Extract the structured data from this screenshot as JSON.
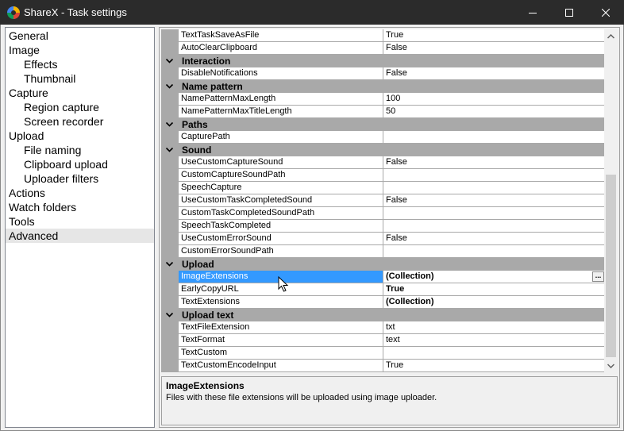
{
  "window": {
    "title": "ShareX - Task settings"
  },
  "tree": {
    "items": [
      {
        "label": "General",
        "child": false,
        "selected": false
      },
      {
        "label": "Image",
        "child": false,
        "selected": false
      },
      {
        "label": "Effects",
        "child": true,
        "selected": false
      },
      {
        "label": "Thumbnail",
        "child": true,
        "selected": false
      },
      {
        "label": "Capture",
        "child": false,
        "selected": false
      },
      {
        "label": "Region capture",
        "child": true,
        "selected": false
      },
      {
        "label": "Screen recorder",
        "child": true,
        "selected": false
      },
      {
        "label": "Upload",
        "child": false,
        "selected": false
      },
      {
        "label": "File naming",
        "child": true,
        "selected": false
      },
      {
        "label": "Clipboard upload",
        "child": true,
        "selected": false
      },
      {
        "label": "Uploader filters",
        "child": true,
        "selected": false
      },
      {
        "label": "Actions",
        "child": false,
        "selected": false
      },
      {
        "label": "Watch folders",
        "child": false,
        "selected": false
      },
      {
        "label": "Tools",
        "child": false,
        "selected": false
      },
      {
        "label": "Advanced",
        "child": false,
        "selected": true
      }
    ]
  },
  "grid": {
    "rows": [
      {
        "type": "prop",
        "name": "TextTaskSaveAsFile",
        "value": "True"
      },
      {
        "type": "prop",
        "name": "AutoClearClipboard",
        "value": "False"
      },
      {
        "type": "cat",
        "name": "Interaction"
      },
      {
        "type": "prop",
        "name": "DisableNotifications",
        "value": "False"
      },
      {
        "type": "cat",
        "name": "Name pattern"
      },
      {
        "type": "prop",
        "name": "NamePatternMaxLength",
        "value": "100"
      },
      {
        "type": "prop",
        "name": "NamePatternMaxTitleLength",
        "value": "50"
      },
      {
        "type": "cat",
        "name": "Paths"
      },
      {
        "type": "prop",
        "name": "CapturePath",
        "value": ""
      },
      {
        "type": "cat",
        "name": "Sound"
      },
      {
        "type": "prop",
        "name": "UseCustomCaptureSound",
        "value": "False"
      },
      {
        "type": "prop",
        "name": "CustomCaptureSoundPath",
        "value": ""
      },
      {
        "type": "prop",
        "name": "SpeechCapture",
        "value": ""
      },
      {
        "type": "prop",
        "name": "UseCustomTaskCompletedSound",
        "value": "False"
      },
      {
        "type": "prop",
        "name": "CustomTaskCompletedSoundPath",
        "value": ""
      },
      {
        "type": "prop",
        "name": "SpeechTaskCompleted",
        "value": ""
      },
      {
        "type": "prop",
        "name": "UseCustomErrorSound",
        "value": "False"
      },
      {
        "type": "prop",
        "name": "CustomErrorSoundPath",
        "value": ""
      },
      {
        "type": "cat",
        "name": "Upload"
      },
      {
        "type": "prop",
        "name": "ImageExtensions",
        "value": "(Collection)",
        "bold": true,
        "selected": true,
        "ellipsis": "..."
      },
      {
        "type": "prop",
        "name": "EarlyCopyURL",
        "value": "True",
        "bold": true
      },
      {
        "type": "prop",
        "name": "TextExtensions",
        "value": "(Collection)",
        "bold": true
      },
      {
        "type": "cat",
        "name": "Upload text"
      },
      {
        "type": "prop",
        "name": "TextFileExtension",
        "value": "txt"
      },
      {
        "type": "prop",
        "name": "TextFormat",
        "value": "text"
      },
      {
        "type": "prop",
        "name": "TextCustom",
        "value": ""
      },
      {
        "type": "prop",
        "name": "TextCustomEncodeInput",
        "value": "True"
      }
    ]
  },
  "description": {
    "title": "ImageExtensions",
    "text": "Files with these file extensions will be uploaded using image uploader."
  },
  "colors": {
    "titlebar": "#2b2b2b",
    "category": "#a9a9a9",
    "selection": "#3399ff"
  },
  "icons": {
    "app": "sharex-logo-icon",
    "minimize": "minimize-icon",
    "maximize": "maximize-icon",
    "close": "close-icon"
  }
}
